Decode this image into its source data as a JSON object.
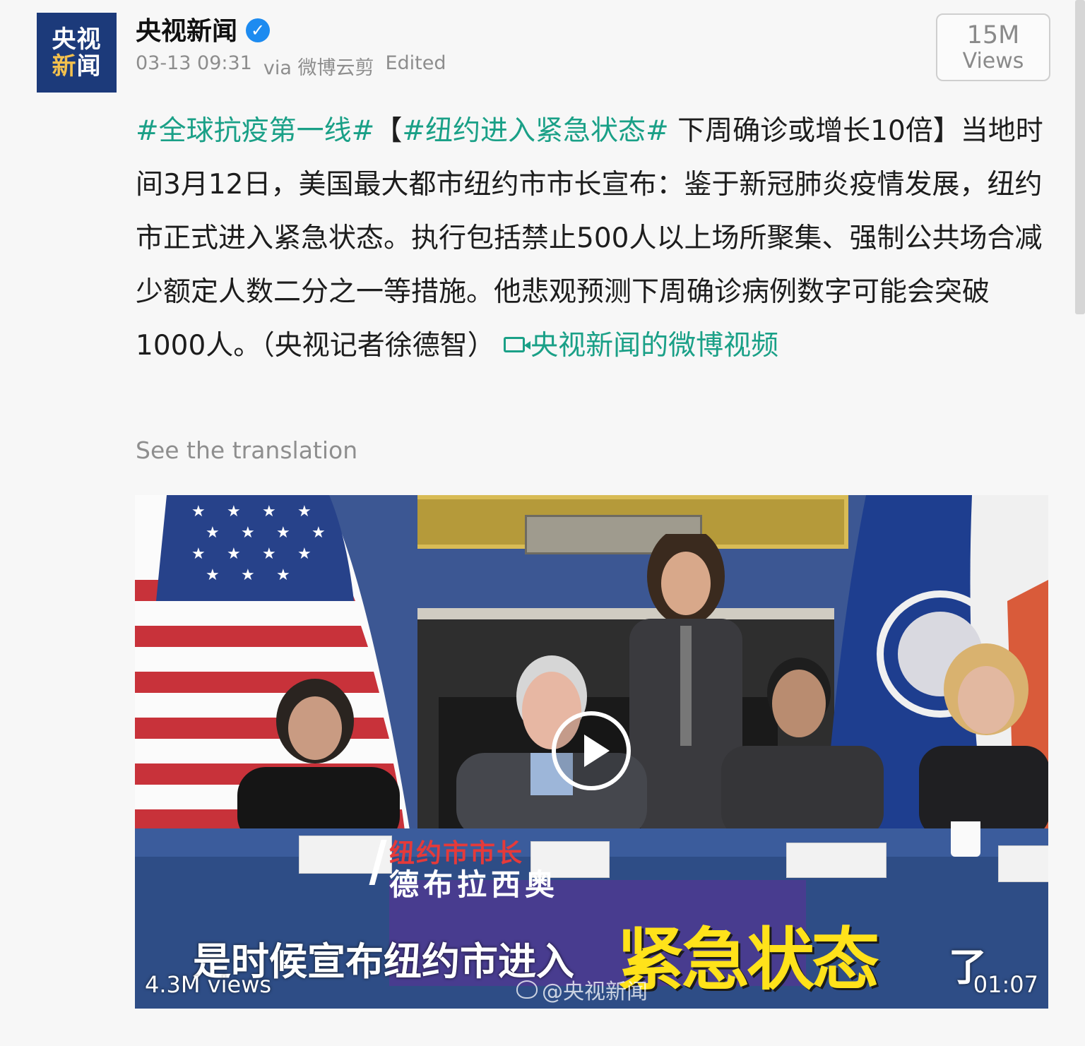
{
  "author": {
    "avatar_line1": "央视",
    "avatar_line2a": "新",
    "avatar_line2b": "闻",
    "name": "央视新闻",
    "verified_icon": "verified-check-icon",
    "timestamp": "03-13 09:31",
    "source": "via 微博云剪",
    "edited": "Edited"
  },
  "views_badge": {
    "count": "15M",
    "unit": "Views"
  },
  "post": {
    "hashtag1": "#全球抗疫第一线#",
    "bracket_open": "【",
    "hashtag2": "#纽约进入紧急状态#",
    "headline_rest": " 下周确诊或增长10倍】",
    "body": "当地时间3月12日，美国最大都市纽约市市长宣布：鉴于新冠肺炎疫情发展，纽约市正式进入紧急状态。执行包括禁止500人以上场所聚集、强制公共场合减少额定人数二分之一等措施。他悲观预测下周确诊病例数字可能会突破1000人。（央视记者徐德智）",
    "video_link_icon": "video-camera-icon",
    "video_link": "央视新闻的微博视频"
  },
  "translate_link": "See the translation",
  "video": {
    "caption_title": "纽约市市长",
    "caption_name": "德布拉西奥",
    "caption_line": "是时候宣布纽约市进入",
    "caption_highlight": "紧急状态",
    "caption_end": "了",
    "views": "4.3M views",
    "duration": "01:07",
    "watermark": "@央视新闻",
    "colors": {
      "highlight": "#ffe21a",
      "caption_red": "#e53a3a",
      "accent": "#1aa087"
    }
  }
}
